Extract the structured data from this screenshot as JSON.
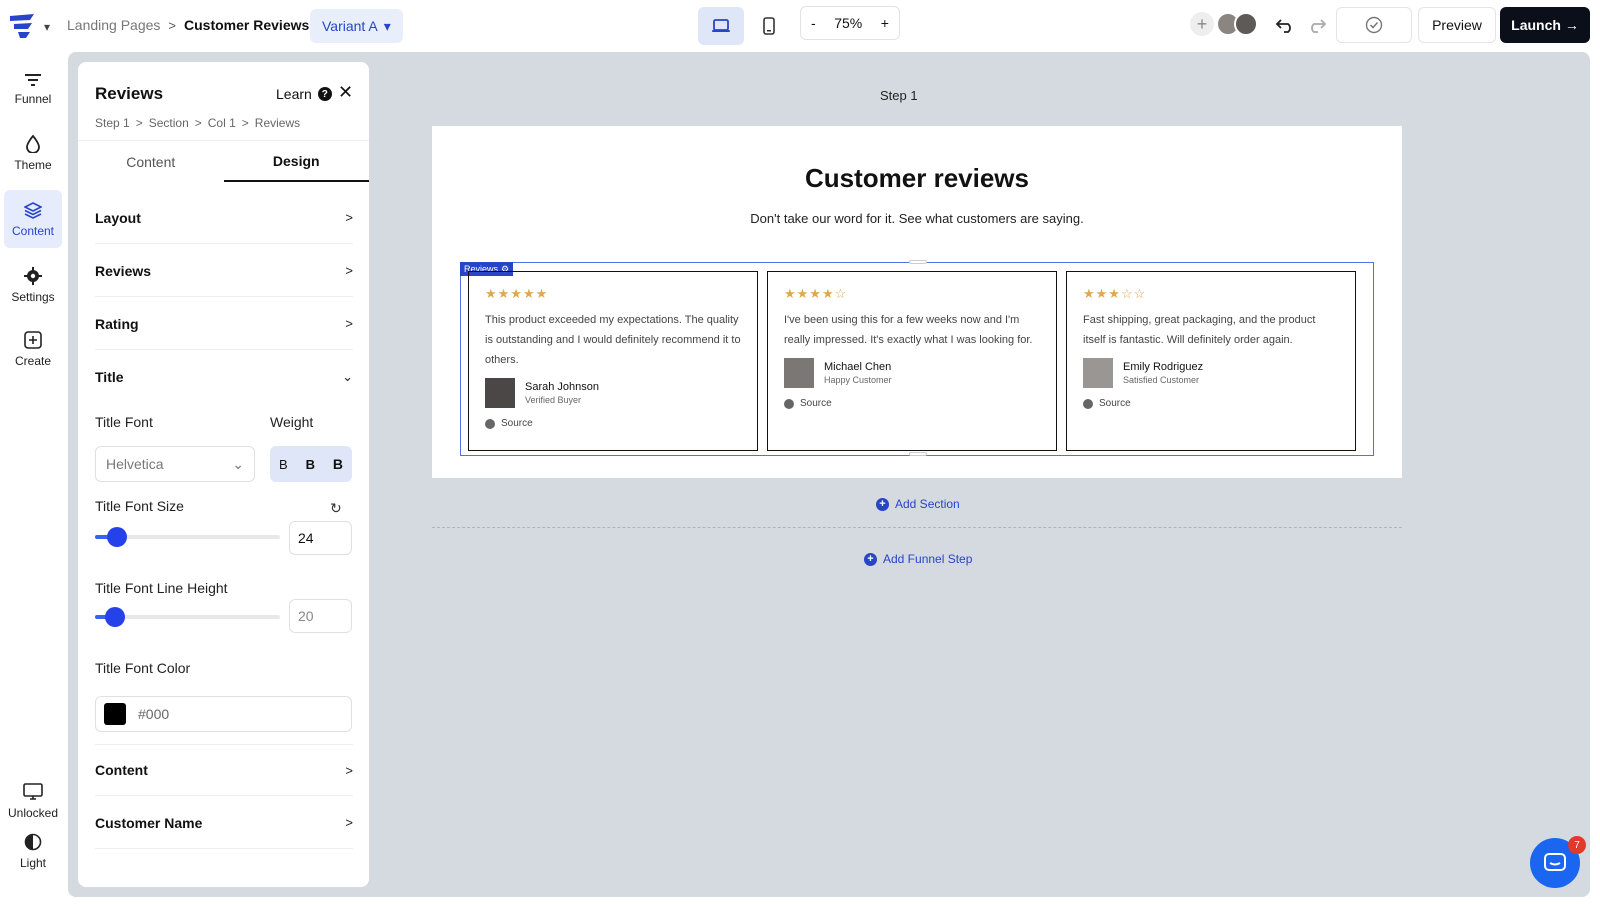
{
  "header": {
    "breadcrumb": [
      "Landing Pages",
      "Customer Reviews"
    ],
    "variant_label": "Variant A",
    "zoom_minus": "-",
    "zoom_value": "75%",
    "zoom_plus": "+",
    "preview_label": "Preview",
    "launch_label": "Launch →"
  },
  "sidebar": {
    "items": [
      {
        "label": "Funnel",
        "icon": "funnel-icon"
      },
      {
        "label": "Theme",
        "icon": "droplet-icon"
      },
      {
        "label": "Content",
        "icon": "layers-icon",
        "active": true
      },
      {
        "label": "Settings",
        "icon": "gear-icon"
      },
      {
        "label": "Create",
        "icon": "plus-square-icon"
      }
    ],
    "bottom": [
      {
        "label": "Unlocked",
        "icon": "monitor-icon"
      },
      {
        "label": "Light",
        "icon": "contrast-icon"
      }
    ]
  },
  "panel": {
    "title": "Reviews",
    "learn": "Learn",
    "breadcrumb": [
      "Step 1",
      "Section",
      "Col 1",
      "Reviews"
    ],
    "tabs": [
      "Content",
      "Design"
    ],
    "sections_top": [
      "Layout",
      "Reviews",
      "Rating",
      "Title"
    ],
    "title_font_label": "Title Font",
    "title_font_value": "Helvetica",
    "weight_label": "Weight",
    "weight_options": [
      "B",
      "B",
      "B"
    ],
    "font_size_label": "Title Font Size",
    "font_size_value": "24",
    "font_size_fraction": 0.12,
    "line_height_label": "Title Font Line Height",
    "line_height_value": "20",
    "line_height_fraction": 0.11,
    "font_color_label": "Title Font Color",
    "font_color_value": "#000",
    "sections_bottom": [
      "Content",
      "Customer Name"
    ]
  },
  "canvas": {
    "step_label": "Step 1",
    "page_title": "Customer reviews",
    "page_subtitle": "Don't take our word for it. See what customers are saying.",
    "reviews_tag": "Reviews",
    "reviews": [
      {
        "rating": 5,
        "text": "This product exceeded my expectations. The quality is outstanding and I would definitely recommend it to others.",
        "name": "Sarah Johnson",
        "role": "Verified Buyer",
        "source": "Source"
      },
      {
        "rating": 4,
        "text": "I've been using this for a few weeks now and I'm really impressed. It's exactly what I was looking for.",
        "name": "Michael Chen",
        "role": "Happy Customer",
        "source": "Source"
      },
      {
        "rating": 3,
        "text": "Fast shipping, great packaging, and the product itself is fantastic. Will definitely order again.",
        "name": "Emily Rodriguez",
        "role": "Satisfied Customer",
        "source": "Source"
      }
    ],
    "add_section": "Add Section",
    "add_funnel_step": "Add Funnel Step"
  },
  "chat": {
    "badge": "7"
  },
  "colors": {
    "accent": "#2845c7",
    "star": "#e0a84a",
    "launch_bg": "#0b0f19"
  }
}
